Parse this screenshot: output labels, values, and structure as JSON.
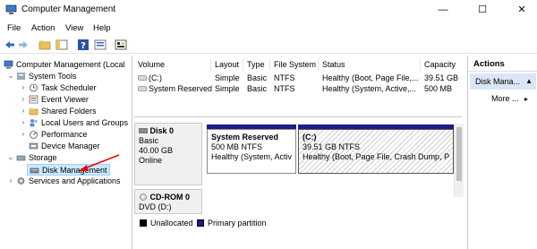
{
  "window": {
    "title": "Computer Management",
    "minimize": "—",
    "maximize": "☐",
    "close": "✕"
  },
  "menu": [
    "File",
    "Action",
    "View",
    "Help"
  ],
  "toolbar": {
    "icons": [
      "back-arrow-icon",
      "forward-arrow-icon",
      "up-folder-icon",
      "show-hide-tree-icon",
      "help-icon",
      "properties-icon",
      "export-icon"
    ]
  },
  "tree": {
    "root": "Computer Management (Local",
    "system_tools": "System Tools",
    "task_scheduler": "Task Scheduler",
    "event_viewer": "Event Viewer",
    "shared_folders": "Shared Folders",
    "local_users": "Local Users and Groups",
    "performance": "Performance",
    "device_manager": "Device Manager",
    "storage": "Storage",
    "disk_management": "Disk Management",
    "services": "Services and Applications"
  },
  "volumes": {
    "headers": [
      "Volume",
      "Layout",
      "Type",
      "File System",
      "Status",
      "Capacity"
    ],
    "rows": [
      [
        "(C:)",
        "Simple",
        "Basic",
        "NTFS",
        "Healthy (Boot, Page File,...",
        "39.51 GB"
      ],
      [
        "System Reserved",
        "Simple",
        "Basic",
        "NTFS",
        "Healthy (System, Active,...",
        "500 MB"
      ]
    ]
  },
  "disks": {
    "disk0": {
      "name": "Disk 0",
      "type": "Basic",
      "size": "40.00 GB",
      "status": "Online",
      "partitions": [
        {
          "name": "System Reserved",
          "size": "500 MB NTFS",
          "status": "Healthy (System, Activ"
        },
        {
          "name": "(C:)",
          "size": "39.51 GB NTFS",
          "status": "Healthy (Boot, Page File, Crash Dump, P"
        }
      ]
    },
    "cdrom0": {
      "name": "CD-ROM 0",
      "type": "DVD (D:)"
    }
  },
  "legend": {
    "unallocated": "Unallocated",
    "primary": "Primary partition",
    "unallocated_color": "#000000",
    "primary_color": "#1b1b8c"
  },
  "actions": {
    "header": "Actions",
    "sub": "Disk Mana...",
    "more": "More ..."
  }
}
